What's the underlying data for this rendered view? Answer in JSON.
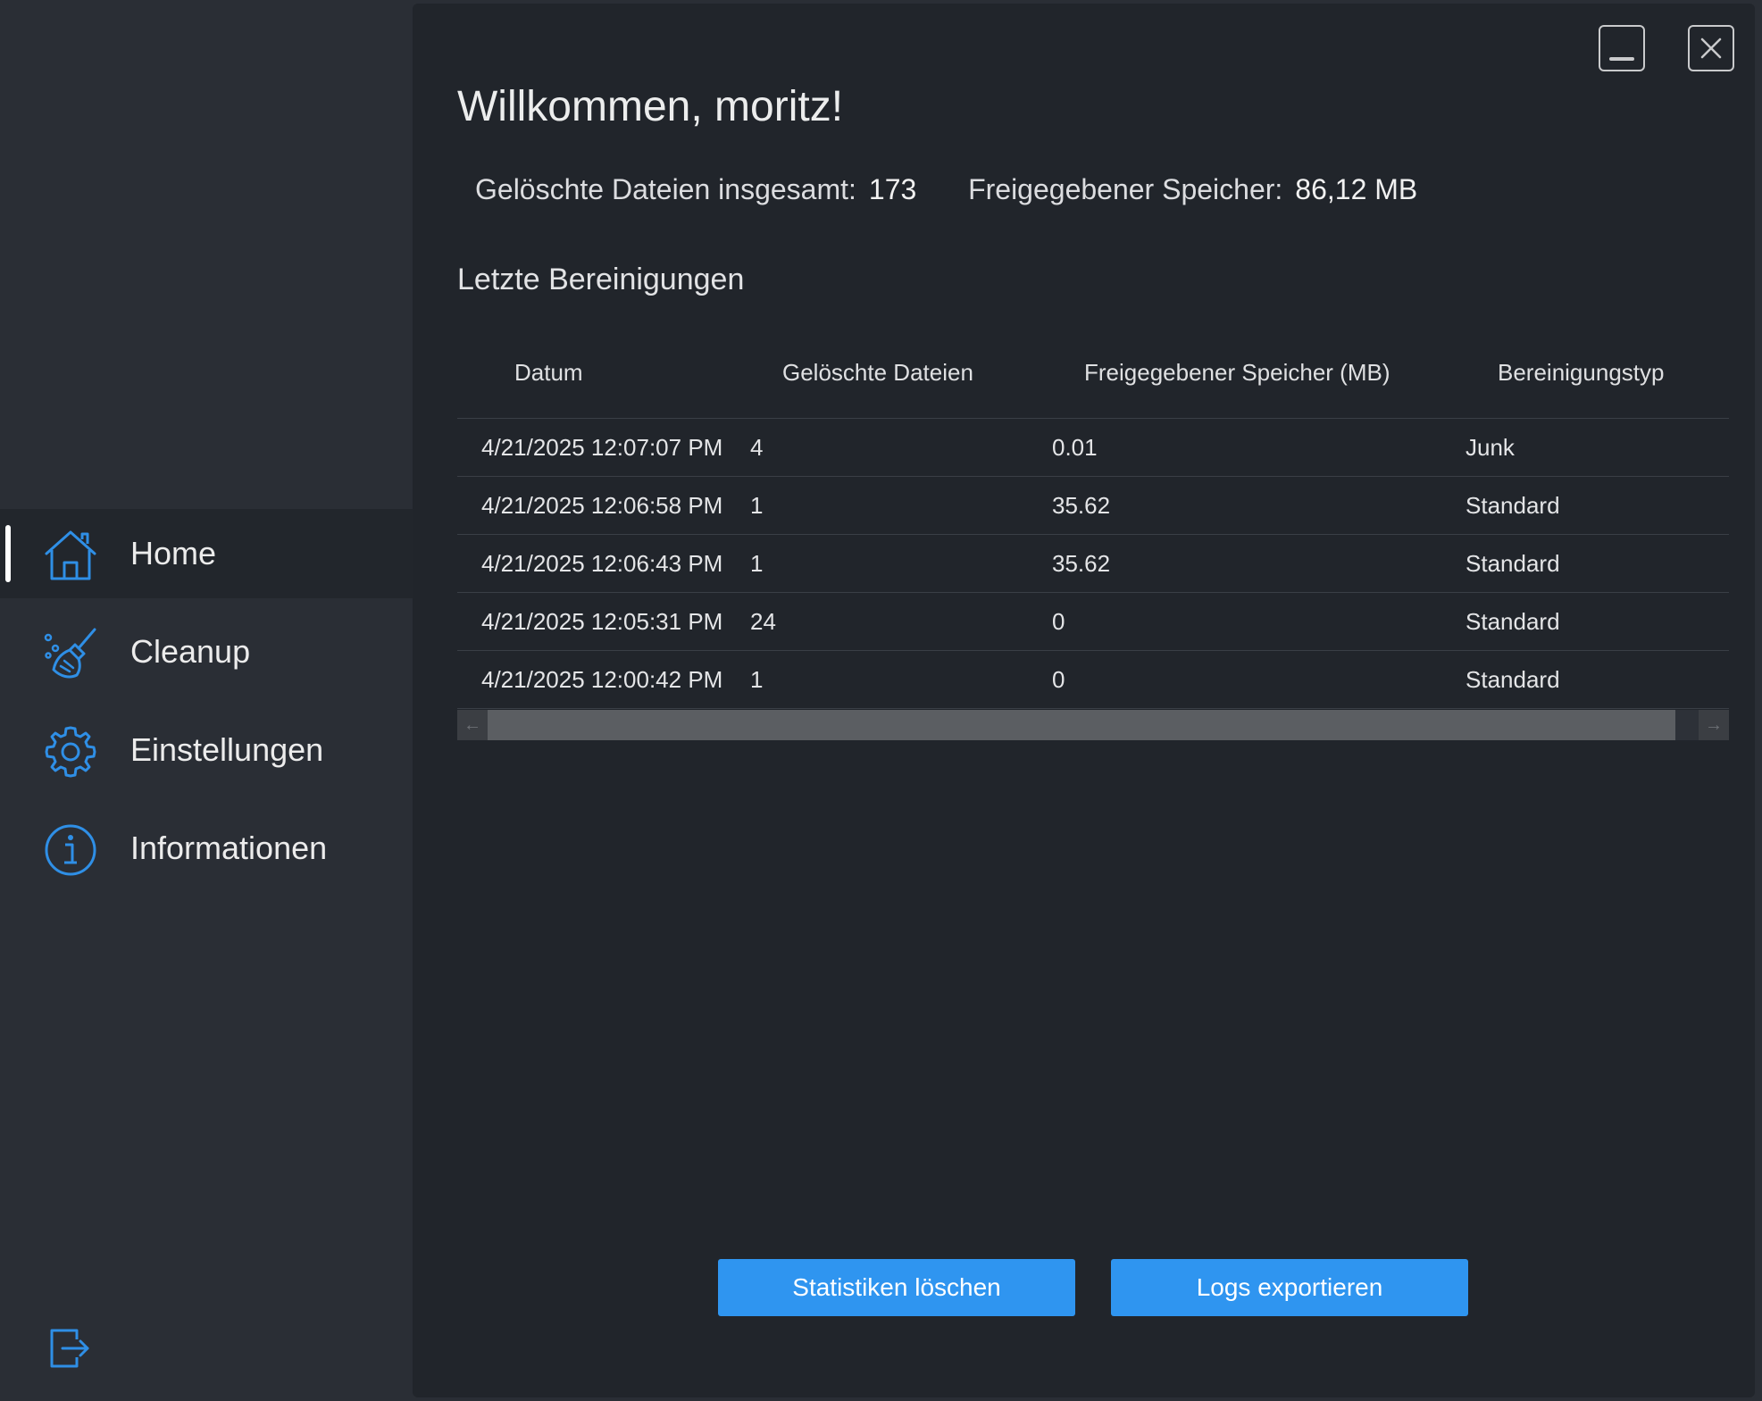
{
  "sidebar": {
    "items": [
      {
        "label": "Home",
        "icon": "home-icon",
        "active": true
      },
      {
        "label": "Cleanup",
        "icon": "broom-icon",
        "active": false
      },
      {
        "label": "Einstellungen",
        "icon": "gear-icon",
        "active": false
      },
      {
        "label": "Informationen",
        "icon": "info-icon",
        "active": false
      }
    ],
    "logout_icon": "logout-icon",
    "accent_color": "#2f8fe6"
  },
  "header": {
    "title": "Willkommen, moritz!"
  },
  "stats": {
    "deleted_files_label": "Gelöschte Dateien insgesamt:",
    "deleted_files_value": "173",
    "freed_space_label": "Freigegebener Speicher:",
    "freed_space_value": "86,12 MB"
  },
  "recent": {
    "title": "Letzte Bereinigungen",
    "columns": [
      "Datum",
      "Gelöschte Dateien",
      "Freigegebener Speicher (MB)",
      "Bereinigungstyp"
    ],
    "rows": [
      [
        "4/21/2025 12:07:07 PM",
        "4",
        "0.01",
        "Junk"
      ],
      [
        "4/21/2025 12:06:58 PM",
        "1",
        "35.62",
        "Standard"
      ],
      [
        "4/21/2025 12:06:43 PM",
        "1",
        "35.62",
        "Standard"
      ],
      [
        "4/21/2025 12:05:31 PM",
        "24",
        "0",
        "Standard"
      ],
      [
        "4/21/2025 12:00:42 PM",
        "1",
        "0",
        "Standard"
      ]
    ]
  },
  "actions": {
    "clear_stats_label": "Statistiken löschen",
    "export_logs_label": "Logs exportieren",
    "button_color": "#2f95f0"
  },
  "window_controls": {
    "minimize_icon": "minimize-icon",
    "close_icon": "close-icon"
  }
}
